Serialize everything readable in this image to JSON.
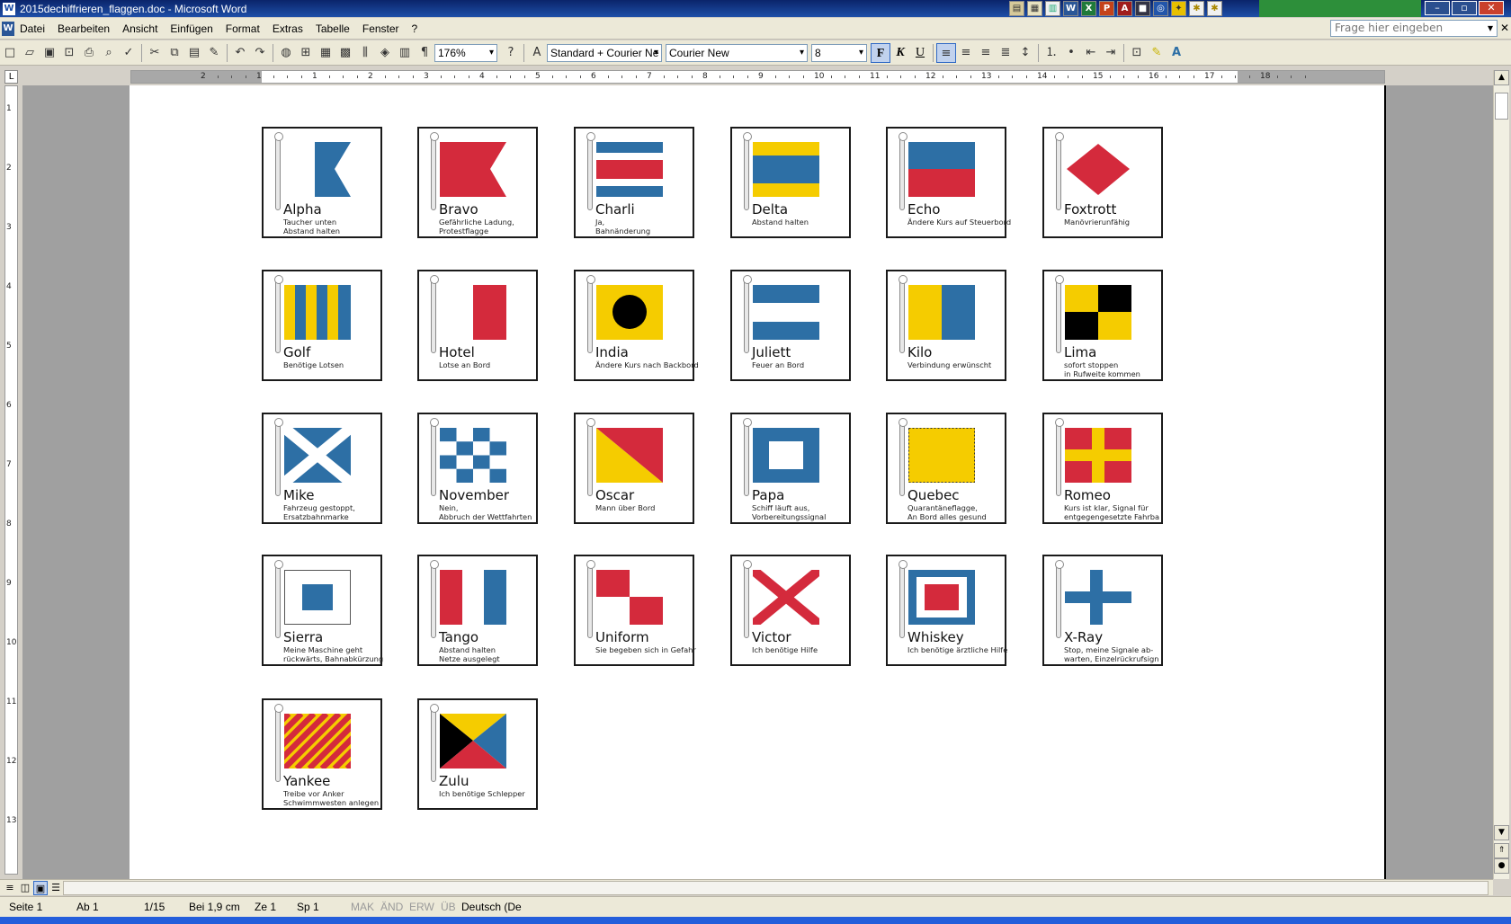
{
  "window": {
    "title": "2015dechiffrieren_flaggen.doc - Microsoft Word"
  },
  "menu": [
    "Datei",
    "Bearbeiten",
    "Ansicht",
    "Einfügen",
    "Format",
    "Extras",
    "Tabelle",
    "Fenster",
    "?"
  ],
  "help_placeholder": "Frage hier eingeben",
  "toolbar": {
    "zoom": "176%",
    "style": "Standard + Courier Ne",
    "font": "Courier New",
    "size": "8",
    "bold": "F",
    "italic": "K",
    "underline": "U"
  },
  "ruler": {
    "marks": [
      "2",
      "1",
      "1",
      "2",
      "3",
      "4",
      "5",
      "6",
      "7",
      "8",
      "9",
      "10",
      "11",
      "12",
      "13",
      "14",
      "15",
      "16",
      "17",
      "18"
    ],
    "vmarks": [
      "1",
      "2",
      "3",
      "4",
      "5",
      "6",
      "7",
      "8",
      "9",
      "10",
      "11",
      "12",
      "13"
    ]
  },
  "colors": {
    "red": "#d42a3c",
    "blue": "#2d6fa5",
    "yellow": "#f5cc00",
    "black": "#000000",
    "white": "#ffffff"
  },
  "flags": [
    {
      "name": "Alpha",
      "desc": "Taucher unten\nAbstand halten",
      "icon": "alpha-flag"
    },
    {
      "name": "Bravo",
      "desc": "Gefährliche Ladung,\nProtestflagge",
      "icon": "bravo-flag"
    },
    {
      "name": "Charli",
      "desc": "Ja,\nBahnänderung",
      "icon": "charlie-flag"
    },
    {
      "name": "Delta",
      "desc": "Abstand halten",
      "icon": "delta-flag"
    },
    {
      "name": "Echo",
      "desc": "Ändere Kurs auf Steuerbord",
      "icon": "echo-flag"
    },
    {
      "name": "Foxtrott",
      "desc": "Manövrierunfähig",
      "icon": "foxtrot-flag"
    },
    {
      "name": "Golf",
      "desc": "Benötige Lotsen",
      "icon": "golf-flag"
    },
    {
      "name": "Hotel",
      "desc": "Lotse an Bord",
      "icon": "hotel-flag"
    },
    {
      "name": "India",
      "desc": "Ändere Kurs nach Backbord",
      "icon": "india-flag"
    },
    {
      "name": "Juliett",
      "desc": "Feuer an Bord",
      "icon": "juliett-flag"
    },
    {
      "name": "Kilo",
      "desc": "Verbindung erwünscht",
      "icon": "kilo-flag"
    },
    {
      "name": "Lima",
      "desc": "sofort stoppen\nin Rufweite kommen",
      "icon": "lima-flag"
    },
    {
      "name": "Mike",
      "desc": "Fahrzeug gestoppt,\nErsatzbahnmarke",
      "icon": "mike-flag"
    },
    {
      "name": "November",
      "desc": "Nein,\nAbbruch der Wettfahrten",
      "icon": "november-flag"
    },
    {
      "name": "Oscar",
      "desc": "Mann über Bord",
      "icon": "oscar-flag"
    },
    {
      "name": "Papa",
      "desc": "Schiff läuft aus,\nVorbereitungssignal",
      "icon": "papa-flag"
    },
    {
      "name": "Quebec",
      "desc": "Quarantäneflagge,\nAn Bord alles gesund",
      "icon": "quebec-flag"
    },
    {
      "name": "Romeo",
      "desc": "Kurs ist klar, Signal für\nentgegengesetzte Fahrba",
      "icon": "romeo-flag"
    },
    {
      "name": "Sierra",
      "desc": "Meine Maschine geht\nrückwärts, Bahnabkürzung",
      "icon": "sierra-flag"
    },
    {
      "name": "Tango",
      "desc": "Abstand halten\nNetze ausgelegt",
      "icon": "tango-flag"
    },
    {
      "name": "Uniform",
      "desc": "Sie begeben sich in Gefahr",
      "icon": "uniform-flag"
    },
    {
      "name": "Victor",
      "desc": "Ich benötige Hilfe",
      "icon": "victor-flag"
    },
    {
      "name": "Whiskey",
      "desc": "Ich benötige ärztliche Hilfe",
      "icon": "whiskey-flag"
    },
    {
      "name": "X-Ray",
      "desc": "Stop, meine Signale ab-\nwarten, Einzelrückrufsign",
      "icon": "xray-flag"
    },
    {
      "name": "Yankee",
      "desc": "Treibe vor Anker\nSchwimmwesten anlegen",
      "icon": "yankee-flag"
    },
    {
      "name": "Zulu",
      "desc": "Ich benötige Schlepper",
      "icon": "zulu-flag"
    }
  ],
  "status": {
    "page": "Seite 1",
    "section": "Ab 1",
    "pages": "1/15",
    "at": "Bei 1,9 cm",
    "line": "Ze 1",
    "col": "Sp 1",
    "rec": "MAK",
    "trk": "ÄND",
    "ext": "ERW",
    "ovr": "ÜB",
    "lang": "Deutsch (De"
  }
}
